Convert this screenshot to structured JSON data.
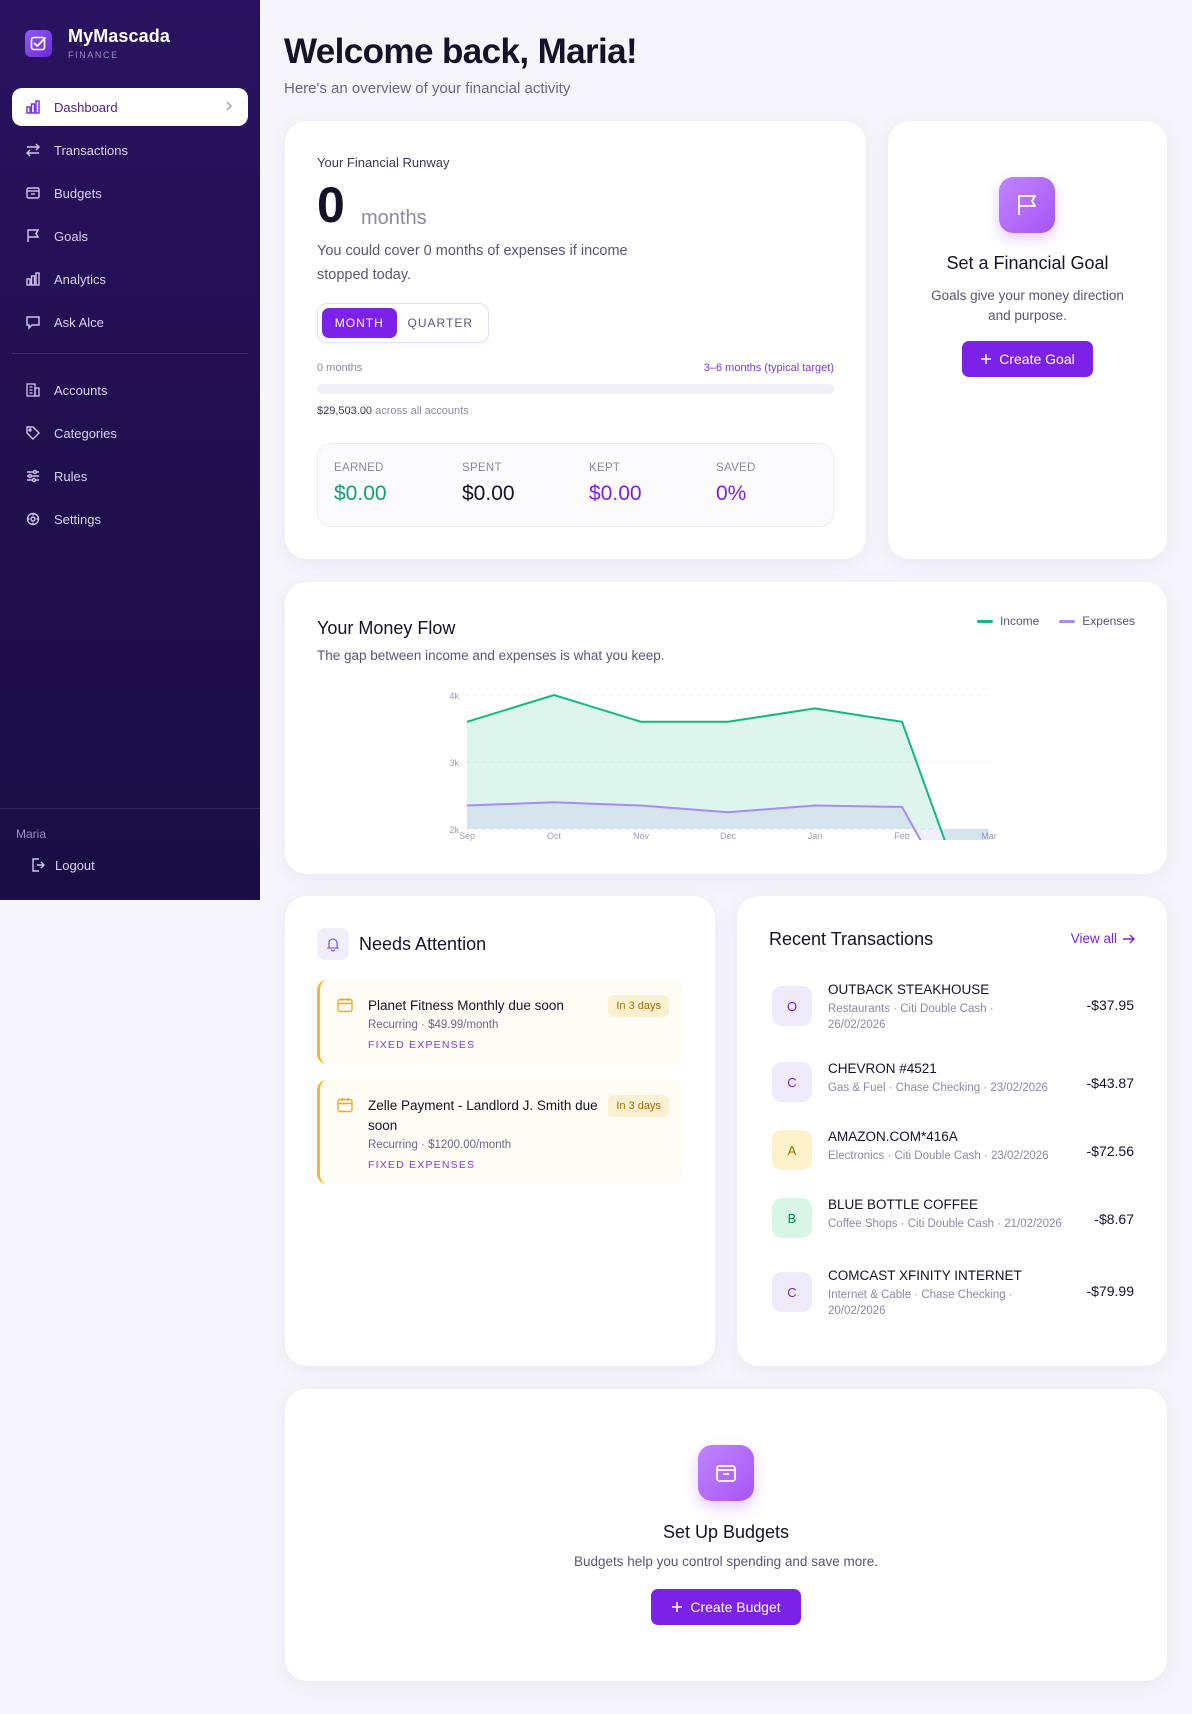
{
  "brand": {
    "name": "MyMascada",
    "sub": "FINANCE"
  },
  "nav": {
    "items": [
      {
        "label": "Dashboard",
        "icon": "bar-chart-icon"
      },
      {
        "label": "Transactions",
        "icon": "arrows-swap-icon"
      },
      {
        "label": "Budgets",
        "icon": "wallet-icon"
      },
      {
        "label": "Goals",
        "icon": "flag-icon"
      },
      {
        "label": "Analytics",
        "icon": "bar-chart-icon"
      },
      {
        "label": "Ask Alce",
        "icon": "chat-icon"
      }
    ],
    "items2": [
      {
        "label": "Accounts",
        "icon": "building-icon"
      },
      {
        "label": "Categories",
        "icon": "tag-icon"
      },
      {
        "label": "Rules",
        "icon": "sliders-icon"
      },
      {
        "label": "Settings",
        "icon": "gear-icon"
      }
    ],
    "user": "Maria",
    "logout": "Logout"
  },
  "header": {
    "title": "Welcome back, Maria!",
    "subtitle": "Here's an overview of your financial activity"
  },
  "runway": {
    "label": "Your Financial Runway",
    "value": "0",
    "unit": "months",
    "description": "You could cover 0 months of expenses if income stopped today.",
    "toggle": {
      "month": "MONTH",
      "quarter": "QUARTER",
      "selected": "MONTH"
    },
    "progress_left": "0 months",
    "progress_right": "3–6 months (typical target)",
    "progress_value": 0,
    "balance": "$29,503.00",
    "balance_suffix": "across all accounts",
    "stats": [
      {
        "label": "EARNED",
        "value": "$0.00",
        "color": "#16a06a"
      },
      {
        "label": "SPENT",
        "value": "$0.00",
        "color": "#151228"
      },
      {
        "label": "KEPT",
        "value": "$0.00",
        "color": "#7c22e8"
      },
      {
        "label": "SAVED",
        "value": "0%",
        "color": "#7c22e8"
      }
    ]
  },
  "goal": {
    "title": "Set a Financial Goal",
    "description": "Goals give your money direction and purpose.",
    "button": "Create Goal"
  },
  "flow": {
    "title": "Your Money Flow",
    "subtitle": "The gap between income and expenses is what you keep.",
    "legend_income": "Income",
    "legend_expenses": "Expenses",
    "income_color": "#10b981",
    "expenses_color": "#a78bfa"
  },
  "chart_data": {
    "type": "area",
    "categories": [
      "Sep",
      "Oct",
      "Nov",
      "Dec",
      "Jan",
      "Feb",
      "Mar"
    ],
    "y_ticks": [
      "4k",
      "3k",
      "2k"
    ],
    "ylim": [
      2000,
      4000
    ],
    "series": [
      {
        "name": "Income",
        "values": [
          3600,
          4000,
          3600,
          3600,
          3800,
          3600,
          0
        ]
      },
      {
        "name": "Expenses",
        "values": [
          2350,
          2400,
          2350,
          2250,
          2350,
          2330,
          0
        ]
      }
    ],
    "grid": true,
    "legend": "top-right"
  },
  "attention": {
    "title": "Needs Attention",
    "items": [
      {
        "title": "Planet Fitness Monthly due soon",
        "meta": "Recurring · $49.99/month",
        "tag": "FIXED EXPENSES",
        "badge": "In 3 days"
      },
      {
        "title": "Zelle Payment - Landlord J. Smith due soon",
        "meta": "Recurring · $1200.00/month",
        "tag": "FIXED EXPENSES",
        "badge": "In 3 days"
      }
    ]
  },
  "transactions": {
    "title": "Recent Transactions",
    "view_all": "View all",
    "items": [
      {
        "initial": "O",
        "name": "OUTBACK STEAKHOUSE",
        "meta": "Restaurants · Citi Double Cash · 26/02/2026",
        "amount": "-$37.95",
        "bg": "#efeafc",
        "fg": "#6d28d9"
      },
      {
        "initial": "C",
        "name": "CHEVRON #4521",
        "meta": "Gas & Fuel · Chase Checking · 23/02/2026",
        "amount": "-$43.87",
        "bg": "#efeafc",
        "fg": "#6d28d9"
      },
      {
        "initial": "A",
        "name": "AMAZON.COM*416A",
        "meta": "Electronics · Citi Double Cash · 23/02/2026",
        "amount": "-$72.56",
        "bg": "#fdf1c9",
        "fg": "#a36a00"
      },
      {
        "initial": "B",
        "name": "BLUE BOTTLE COFFEE",
        "meta": "Coffee Shops · Citi Double Cash · 21/02/2026",
        "amount": "-$8.67",
        "bg": "#d8f6e6",
        "fg": "#0f8a55"
      },
      {
        "initial": "C",
        "name": "COMCAST XFINITY INTERNET",
        "meta": "Internet & Cable · Chase Checking · 20/02/2026",
        "amount": "-$79.99",
        "bg": "#efeafc",
        "fg": "#6d28d9"
      }
    ]
  },
  "budget": {
    "title": "Set Up Budgets",
    "description": "Budgets help you control spending and save more.",
    "button": "Create Budget"
  }
}
